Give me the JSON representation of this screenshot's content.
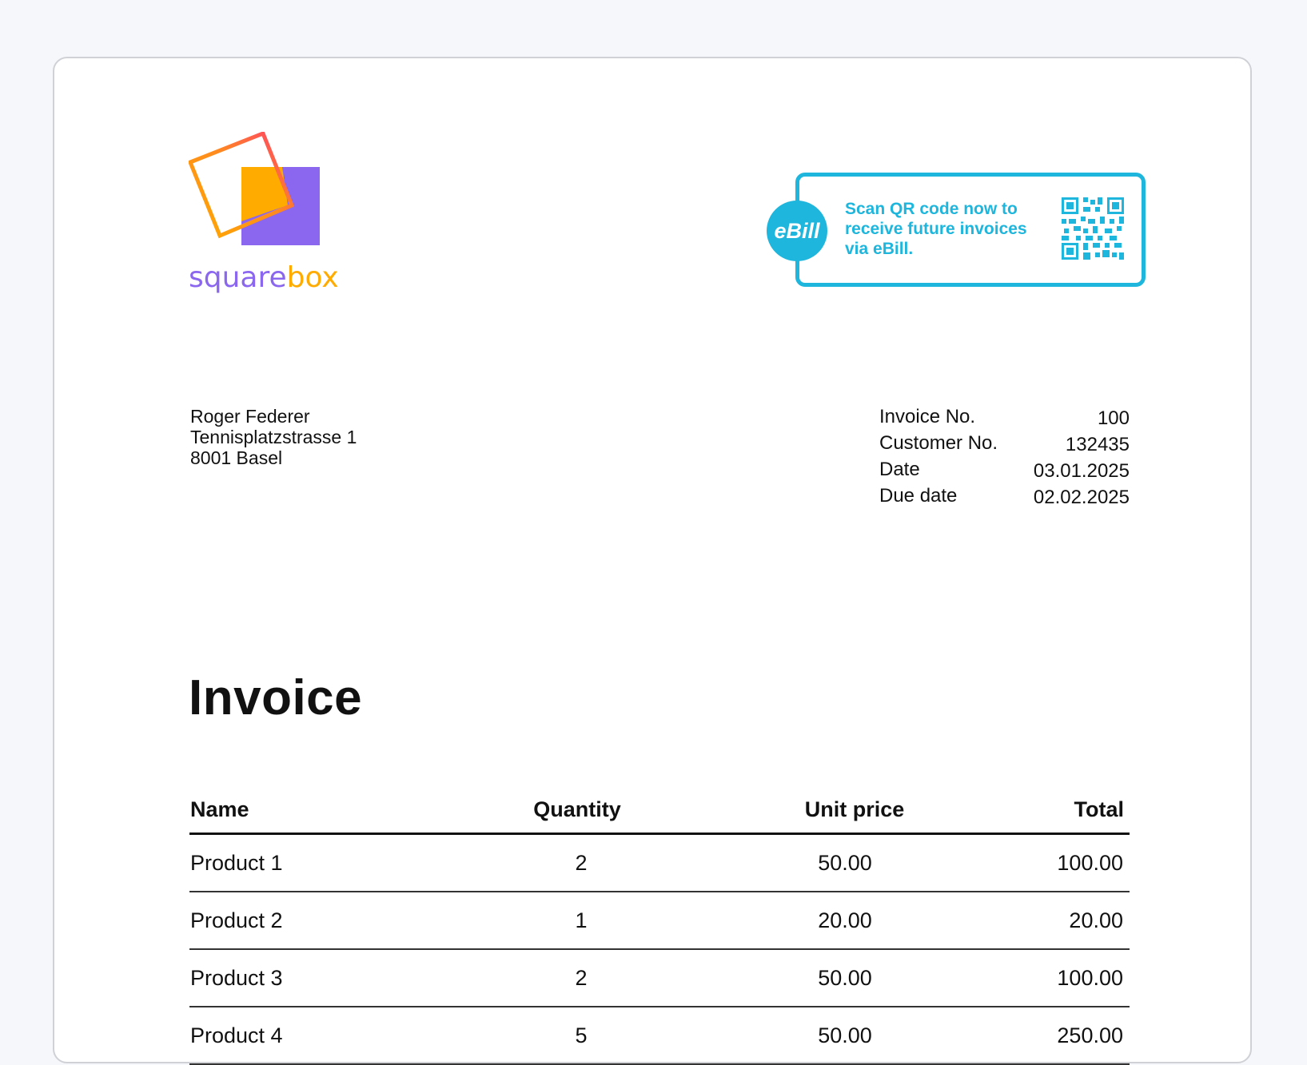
{
  "logo": {
    "text_part1": "square",
    "text_part2": "box",
    "colors": {
      "purple": "#8b67f0",
      "orange": "#ffab00",
      "gradient_end": "#ff3d6e"
    }
  },
  "ebill": {
    "badge_label": "eBill",
    "message": "Scan QR code now to receive future invoices via eBill.",
    "accent_color": "#1eb6dc",
    "qr_icon": "qr-code-icon"
  },
  "recipient": {
    "name": "Roger Federer",
    "street": "Tennisplatzstrasse 1",
    "city": "8001 Basel"
  },
  "meta": [
    {
      "label": "Invoice No.",
      "value": "100"
    },
    {
      "label": "Customer No.",
      "value": "132435"
    },
    {
      "label": "Date",
      "value": "03.01.2025"
    },
    {
      "label": "Due date",
      "value": "02.02.2025"
    }
  ],
  "title": "Invoice",
  "table": {
    "headers": {
      "name": "Name",
      "quantity": "Quantity",
      "unit_price": "Unit price",
      "total": "Total"
    },
    "rows": [
      {
        "name": "Product 1",
        "quantity": "2",
        "unit_price": "50.00",
        "total": "100.00"
      },
      {
        "name": "Product 2",
        "quantity": "1",
        "unit_price": "20.00",
        "total": "20.00"
      },
      {
        "name": "Product 3",
        "quantity": "2",
        "unit_price": "50.00",
        "total": "100.00"
      },
      {
        "name": "Product 4",
        "quantity": "5",
        "unit_price": "50.00",
        "total": "250.00"
      }
    ]
  }
}
